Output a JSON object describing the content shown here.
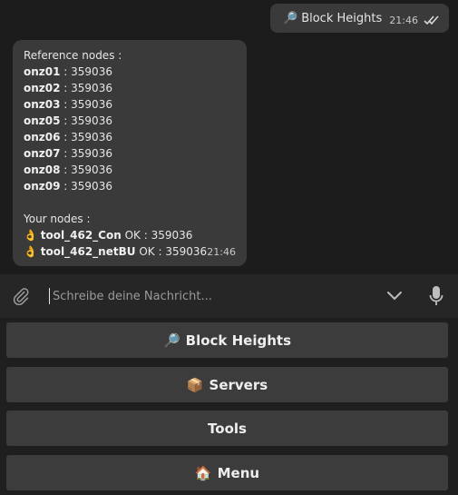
{
  "outgoing": {
    "emoji": "🔎",
    "text": "Block Heights",
    "time": "21:46"
  },
  "incoming": {
    "reference_title": "Reference nodes :",
    "reference_nodes": [
      {
        "name": "onz01",
        "value": "359036"
      },
      {
        "name": "onz02",
        "value": "359036"
      },
      {
        "name": "onz03",
        "value": "359036"
      },
      {
        "name": "onz05",
        "value": "359036"
      },
      {
        "name": "onz06",
        "value": "359036"
      },
      {
        "name": "onz07",
        "value": "359036"
      },
      {
        "name": "onz08",
        "value": "359036"
      },
      {
        "name": "onz09",
        "value": "359036"
      }
    ],
    "your_title": "Your nodes :",
    "your_nodes": [
      {
        "emoji": "👌",
        "name": "tool_462_Con",
        "status": "OK",
        "value": "359036"
      },
      {
        "emoji": "👌",
        "name": "tool_462_netBU",
        "status": "OK",
        "value": "359036"
      }
    ],
    "time": "21:46"
  },
  "composer": {
    "placeholder": "Schreibe deine Nachricht..."
  },
  "keyboard": {
    "buttons": [
      {
        "emoji": "🔎",
        "label": "Block Heights"
      },
      {
        "emoji": "📦",
        "label": "Servers"
      },
      {
        "emoji": "",
        "label": "Tools"
      },
      {
        "emoji": "🏠",
        "label": "Menu"
      }
    ]
  },
  "colors": {
    "bubble": "#3a3a3a",
    "background": "#1c1c1c",
    "button": "#3c3c3c"
  }
}
